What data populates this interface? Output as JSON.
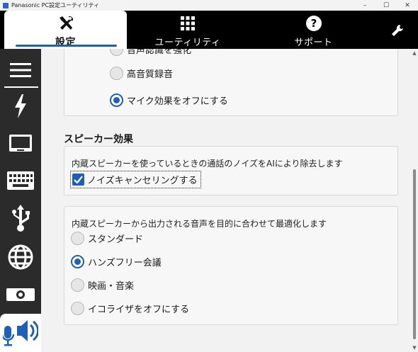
{
  "window": {
    "title": "Panasonic PC設定ユーティリティ",
    "minimize_glyph": "–",
    "maximize_glyph": "☐",
    "close_glyph": "✕"
  },
  "topnav": {
    "tabs": [
      {
        "label": "設定",
        "icon": "tools-icon",
        "active": true
      },
      {
        "label": "ユーティリティ",
        "icon": "grid-icon",
        "active": false
      },
      {
        "label": "サポート",
        "icon": "help-icon",
        "active": false
      }
    ],
    "wrench_icon": "wrench-icon"
  },
  "sidebar": {
    "items": [
      {
        "icon": "menu-icon"
      },
      {
        "icon": "power-icon"
      },
      {
        "icon": "display-icon"
      },
      {
        "icon": "keyboard-icon"
      },
      {
        "icon": "usb-icon"
      },
      {
        "icon": "network-icon"
      },
      {
        "icon": "camera-icon"
      },
      {
        "icon": "audio-icon",
        "active": true
      }
    ]
  },
  "main": {
    "mic_card": {
      "options": [
        {
          "label": "音声認識を強化",
          "selected": false
        },
        {
          "label": "高音質録音",
          "selected": false
        },
        {
          "label": "マイク効果をオフにする",
          "selected": true
        }
      ]
    },
    "speaker_section": {
      "title": "スピーカー効果",
      "noise_card": {
        "description": "内蔵スピーカーを使っているときの通話のノイズをAIにより除去します",
        "checkbox_label": "ノイズキャンセリングする",
        "checked": true
      },
      "optimize_card": {
        "description": "内蔵スピーカーから出力される音声を目的に合わせて最適化します",
        "options": [
          {
            "label": "スタンダード",
            "selected": false
          },
          {
            "label": "ハンズフリー会議",
            "selected": true
          },
          {
            "label": "映画・音楽",
            "selected": false
          },
          {
            "label": "イコライザをオフにする",
            "selected": false
          }
        ]
      }
    }
  },
  "colors": {
    "accent": "#1f5fb5",
    "nav_bg": "#000000",
    "sidebar_bg": "#2b2b2b",
    "content_bg": "#f2f2f2"
  }
}
